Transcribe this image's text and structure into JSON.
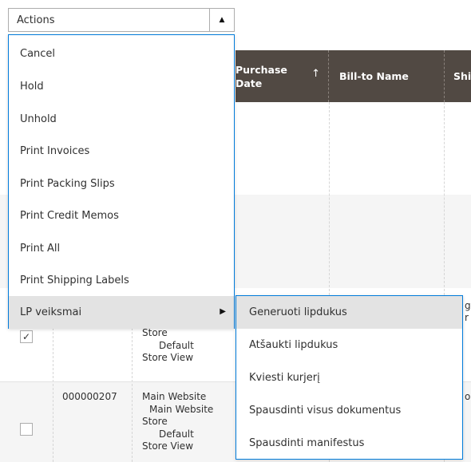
{
  "actions": {
    "label": "Actions",
    "items": [
      {
        "label": "Cancel"
      },
      {
        "label": "Hold"
      },
      {
        "label": "Unhold"
      },
      {
        "label": "Print Invoices"
      },
      {
        "label": "Print Packing Slips"
      },
      {
        "label": "Print Credit Memos"
      },
      {
        "label": "Print All"
      },
      {
        "label": "Print Shipping Labels"
      },
      {
        "label": "LP veiksmai"
      }
    ],
    "submenu": [
      {
        "label": "Generuoti lipdukus"
      },
      {
        "label": "Atšaukti lipdukus"
      },
      {
        "label": "Kviesti kurjerį"
      },
      {
        "label": "Spausdinti visus dokumentus"
      },
      {
        "label": "Spausdinti manifestus"
      }
    ]
  },
  "grid": {
    "headers": {
      "purchase_date": "Purchase Date",
      "sort_arrow": "↑",
      "bill_to_name": "Bill-to Name",
      "ship_partial": "Shi"
    },
    "rows": [
      {
        "checked": true,
        "purchase_point_lines": [
          "Store",
          "Default",
          "Store View"
        ]
      },
      {
        "checked": false,
        "id": "000000207",
        "purchase_point_lines": [
          "Main Website",
          "Main Website",
          "Store",
          "Default",
          "Store View"
        ]
      }
    ],
    "edge_fragments": [
      "g",
      "r",
      "o"
    ]
  },
  "colors": {
    "header_bg": "#514943",
    "menu_border": "#007bdb",
    "active_bg": "#e3e3e3"
  }
}
